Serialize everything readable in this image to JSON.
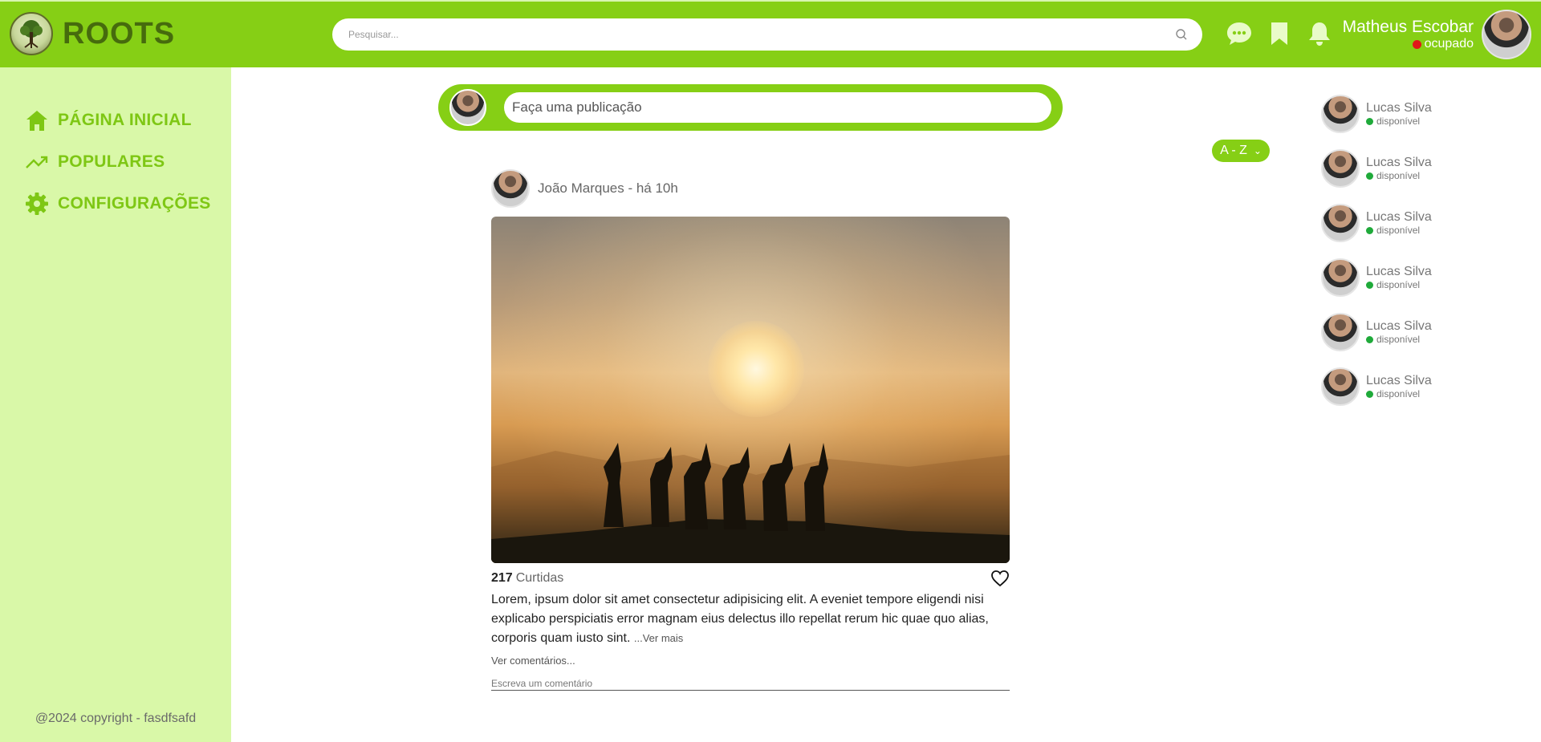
{
  "brand": {
    "name": "ROOTS"
  },
  "search": {
    "placeholder": "Pesquisar..."
  },
  "header_icons": [
    "chat-bubble-icon",
    "bookmark-icon",
    "bell-icon"
  ],
  "user": {
    "name": "Matheus Escobar",
    "status": "ocupado",
    "status_color": "#e01818"
  },
  "sidebar": {
    "items": [
      {
        "label": "PÁGINA INICIAL",
        "icon": "home-icon"
      },
      {
        "label": "POPULARES",
        "icon": "trending-up-icon"
      },
      {
        "label": "CONFIGURAÇÕES",
        "icon": "gear-icon"
      }
    ],
    "copyright": "@2024 copyright - fasdfsafd"
  },
  "composer": {
    "placeholder": "Faça uma publicação"
  },
  "sort": {
    "label": "A - Z"
  },
  "post": {
    "author": "João Marques",
    "time": "há 10h",
    "likes_count": "217",
    "likes_label": "Curtidas",
    "body": "Lorem, ipsum dolor sit amet consectetur adipisicing elit. A eveniet tempore eligendi nisi explicabo perspiciatis error magnam eius delectus illo repellat rerum hic quae quo alias, corporis quam iusto sint.",
    "see_more": "...Ver mais",
    "comments_link": "Ver comentários...",
    "comment_placeholder": "Escreva um comentário"
  },
  "friends": [
    {
      "name": "Lucas Silva",
      "status": "disponível"
    },
    {
      "name": "Lucas Silva",
      "status": "disponível"
    },
    {
      "name": "Lucas Silva",
      "status": "disponível"
    },
    {
      "name": "Lucas Silva",
      "status": "disponível"
    },
    {
      "name": "Lucas Silva",
      "status": "disponível"
    },
    {
      "name": "Lucas Silva",
      "status": "disponível"
    }
  ],
  "colors": {
    "primary": "#86cf15",
    "sidebar": "#d9f8a8",
    "available": "#1faa3a",
    "busy": "#e01818"
  }
}
